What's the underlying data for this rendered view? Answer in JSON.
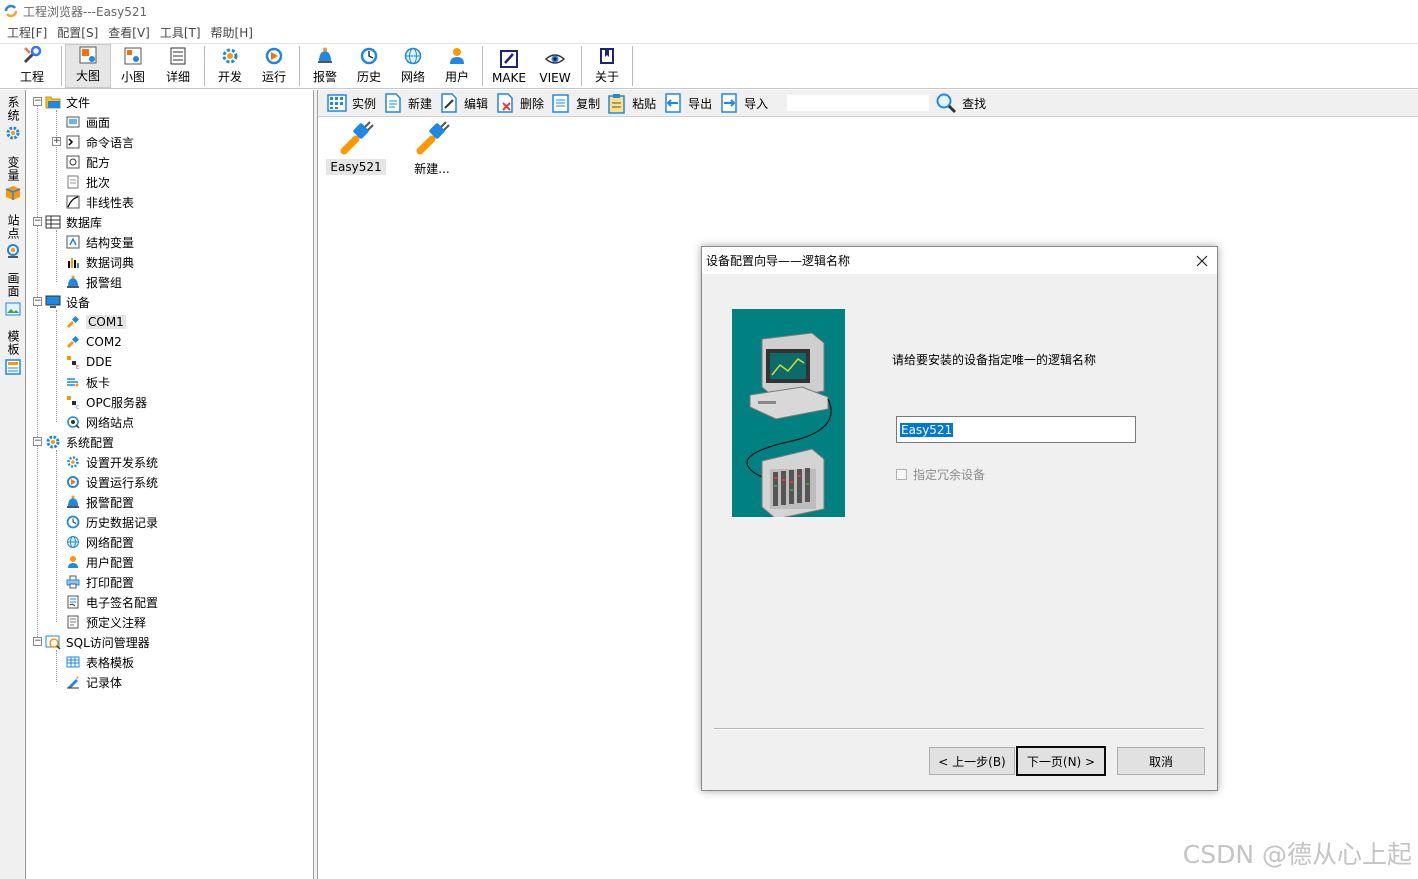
{
  "window": {
    "title": "工程浏览器---Easy521"
  },
  "menu": [
    "工程[F]",
    "配置[S]",
    "查看[V]",
    "工具[T]",
    "帮助[H]"
  ],
  "toolbar": {
    "project": "工程",
    "large": "大图",
    "small": "小图",
    "detail": "详细",
    "develop": "开发",
    "run": "运行",
    "alarm": "报警",
    "history": "历史",
    "network": "网络",
    "user": "用户",
    "make": "MAKE",
    "view": "VIEW",
    "about": "关于"
  },
  "sidetabs": [
    "系统",
    "变量",
    "站点",
    "画面",
    "模板"
  ],
  "tree": {
    "file": "文件",
    "screen": "画面",
    "command_lang": "命令语言",
    "recipe": "配方",
    "batch": "批次",
    "nonlinear": "非线性表",
    "database": "数据库",
    "struct_var": "结构变量",
    "data_dict": "数据词典",
    "alarm_group": "报警组",
    "device": "设备",
    "com1": "COM1",
    "com2": "COM2",
    "dde": "DDE",
    "board": "板卡",
    "opc": "OPC服务器",
    "net_station": "网络站点",
    "sysconfig": "系统配置",
    "set_dev": "设置开发系统",
    "set_run": "设置运行系统",
    "alarm_cfg": "报警配置",
    "hist_rec": "历史数据记录",
    "net_cfg": "网络配置",
    "user_cfg": "用户配置",
    "print_cfg": "打印配置",
    "esign_cfg": "电子签名配置",
    "predef_note": "预定义注释",
    "sql": "SQL访问管理器",
    "table_tpl": "表格模板",
    "record": "记录体"
  },
  "content_toolbar": {
    "instance": "实例",
    "new": "新建",
    "edit": "编辑",
    "delete": "删除",
    "copy": "复制",
    "paste": "粘贴",
    "export": "导出",
    "import": "导入",
    "search_value": "",
    "find": "查找"
  },
  "content": {
    "items": [
      "Easy521",
      "新建..."
    ]
  },
  "dialog": {
    "title": "设备配置向导——逻辑名称",
    "prompt": "请给要安装的设备指定唯一的逻辑名称",
    "input_value": "Easy521",
    "redundant_label": "指定冗余设备",
    "prev": "< 上一步(B)",
    "next": "下一页(N) >",
    "cancel": "取消"
  },
  "watermark": "CSDN @德从心上起"
}
